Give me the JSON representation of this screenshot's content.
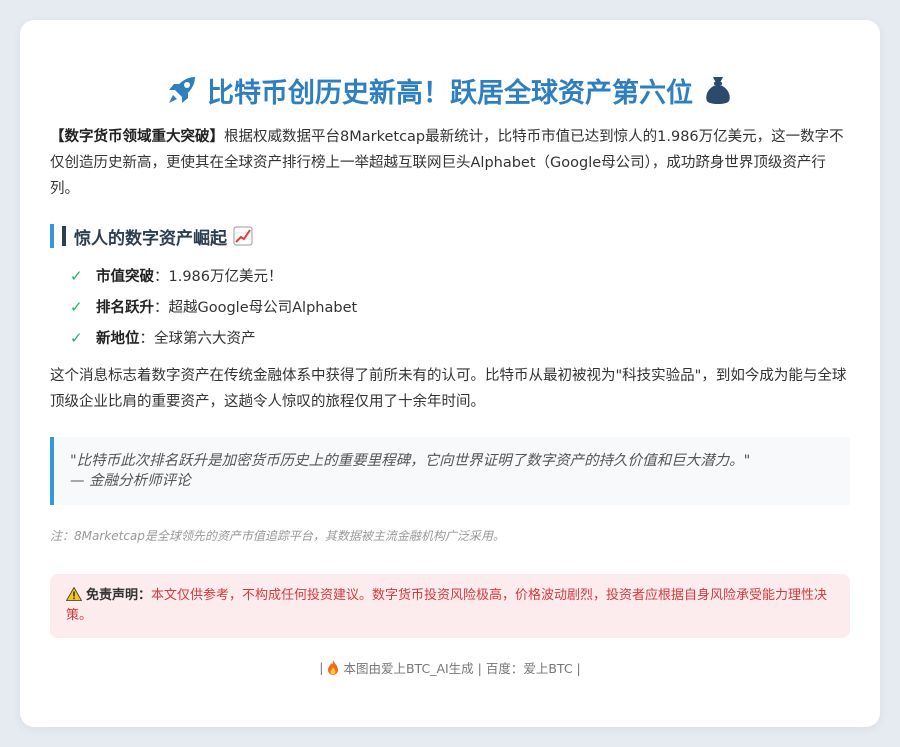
{
  "article": {
    "title": "比特币创历史新高！跃居全球资产第六位",
    "icons": {
      "left": "rocket-icon",
      "right": "money-bag-icon"
    },
    "intro": {
      "lead": "【数字货币领域重大突破】",
      "text": "根据权威数据平台8Marketcap最新统计，比特币市值已达到惊人的1.986万亿美元，这一数字不仅创造历史新高，更使其在全球资产排行榜上一举超越互联网巨头Alphabet（Google母公司），成功跻身世界顶级资产行列。"
    },
    "section_heading": "惊人的数字资产崛起",
    "section_icon": "chart-increasing-icon",
    "points": [
      {
        "label": "市值突破",
        "text": "：1.986万亿美元！"
      },
      {
        "label": "排名跃升",
        "text": "：超越Google母公司Alphabet"
      },
      {
        "label": "新地位",
        "text": "：全球第六大资产"
      }
    ],
    "paragraph": "这个消息标志着数字资产在传统金融体系中获得了前所未有的认可。比特币从最初被视为\"科技实验品\"，到如今成为能与全球顶级企业比肩的重要资产，这趟令人惊叹的旅程仅用了十余年时间。",
    "quote": {
      "text": "\"比特币此次排名跃升是加密货币历史上的重要里程碑，它向世界证明了数字资产的持久价值和巨大潜力。\"",
      "source": "— 金融分析师评论"
    },
    "note": "注：8Marketcap是全球领先的资产市值追踪平台，其数据被主流金融机构广泛采用。",
    "disclaimer": {
      "label": "免责声明：",
      "text": "本文仅供参考，不构成任何投资建议。数字货币投资风险极高，价格波动剧烈，投资者应根据自身风险承受能力理性决策。"
    },
    "footer": {
      "prefix": "|",
      "text": "本图由爱上BTC_AI生成 | 百度：爱上BTC |"
    }
  },
  "colors": {
    "title": "#2e7fc0",
    "accent": "#3498db",
    "check": "#27ae60",
    "disclaimer_bg": "#fdecee",
    "disclaimer_text": "#d63a3a"
  }
}
